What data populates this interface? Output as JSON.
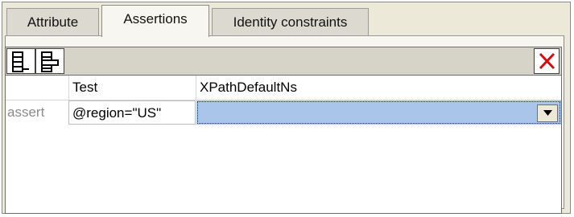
{
  "tabs": [
    {
      "label": "Attribute",
      "active": false
    },
    {
      "label": "Assertions",
      "active": true
    },
    {
      "label": "Identity constraints",
      "active": false
    }
  ],
  "toolbar": {
    "buttons": [
      "append-row-icon",
      "insert-row-icon"
    ],
    "delete_icon": "close-icon",
    "delete_color": "#cc1111"
  },
  "grid": {
    "columns": [
      "Test",
      "XPathDefaultNs"
    ],
    "rows": [
      {
        "kind": "assert",
        "test": "@region=\"US\"",
        "xpath_default_ns": ""
      }
    ]
  },
  "colors": {
    "selected_cell": "#a9c6ea",
    "row_label": "#8c8c8c"
  }
}
